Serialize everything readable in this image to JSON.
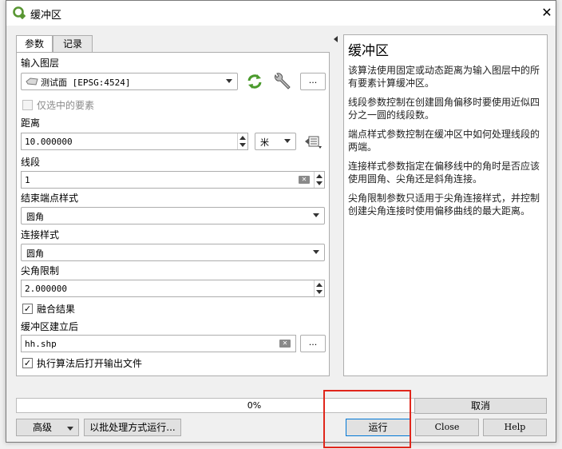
{
  "window": {
    "title": "缓冲区",
    "close_glyph": "✕"
  },
  "tabs": [
    {
      "label": "参数"
    },
    {
      "label": "记录"
    }
  ],
  "params": {
    "input_layer": {
      "label": "输入图层",
      "value": "测试面 [EPSG:4524]"
    },
    "selected_only": {
      "label": "仅选中的要素",
      "checked": false
    },
    "distance": {
      "label": "距离",
      "value": "10.000000",
      "unit": "米"
    },
    "segments": {
      "label": "线段",
      "value": "1"
    },
    "end_cap": {
      "label": "结束端点样式",
      "value": "圆角"
    },
    "join_style": {
      "label": "连接样式",
      "value": "圆角"
    },
    "miter_limit": {
      "label": "尖角限制",
      "value": "2.000000"
    },
    "dissolve": {
      "label": "融合结果",
      "checked": true
    },
    "output": {
      "label": "缓冲区建立后",
      "value": "hh.shp"
    },
    "open_after": {
      "label": "执行算法后打开输出文件",
      "checked": true
    },
    "dots": "..."
  },
  "help": {
    "title": "缓冲区",
    "paragraphs": [
      "该算法使用固定或动态距离为输入图层中的所有要素计算缓冲区。",
      "线段参数控制在创建圆角偏移时要使用近似四分之一圆的线段数。",
      "端点样式参数控制在缓冲区中如何处理线段的两端。",
      "连接样式参数指定在偏移线中的角时是否应该使用圆角、尖角还是斜角连接。",
      "尖角限制参数只适用于尖角连接样式，并控制创建尖角连接时使用偏移曲线的最大距离。"
    ]
  },
  "progress": {
    "value": 0,
    "label": "0%"
  },
  "buttons": {
    "cancel": "取消",
    "advanced": "高级",
    "batch": "以批处理方式运行...",
    "run": "运行",
    "close": "Close",
    "help": "Help"
  },
  "colors": {
    "highlight": "#e0261b",
    "qgis_green": "#589632"
  }
}
